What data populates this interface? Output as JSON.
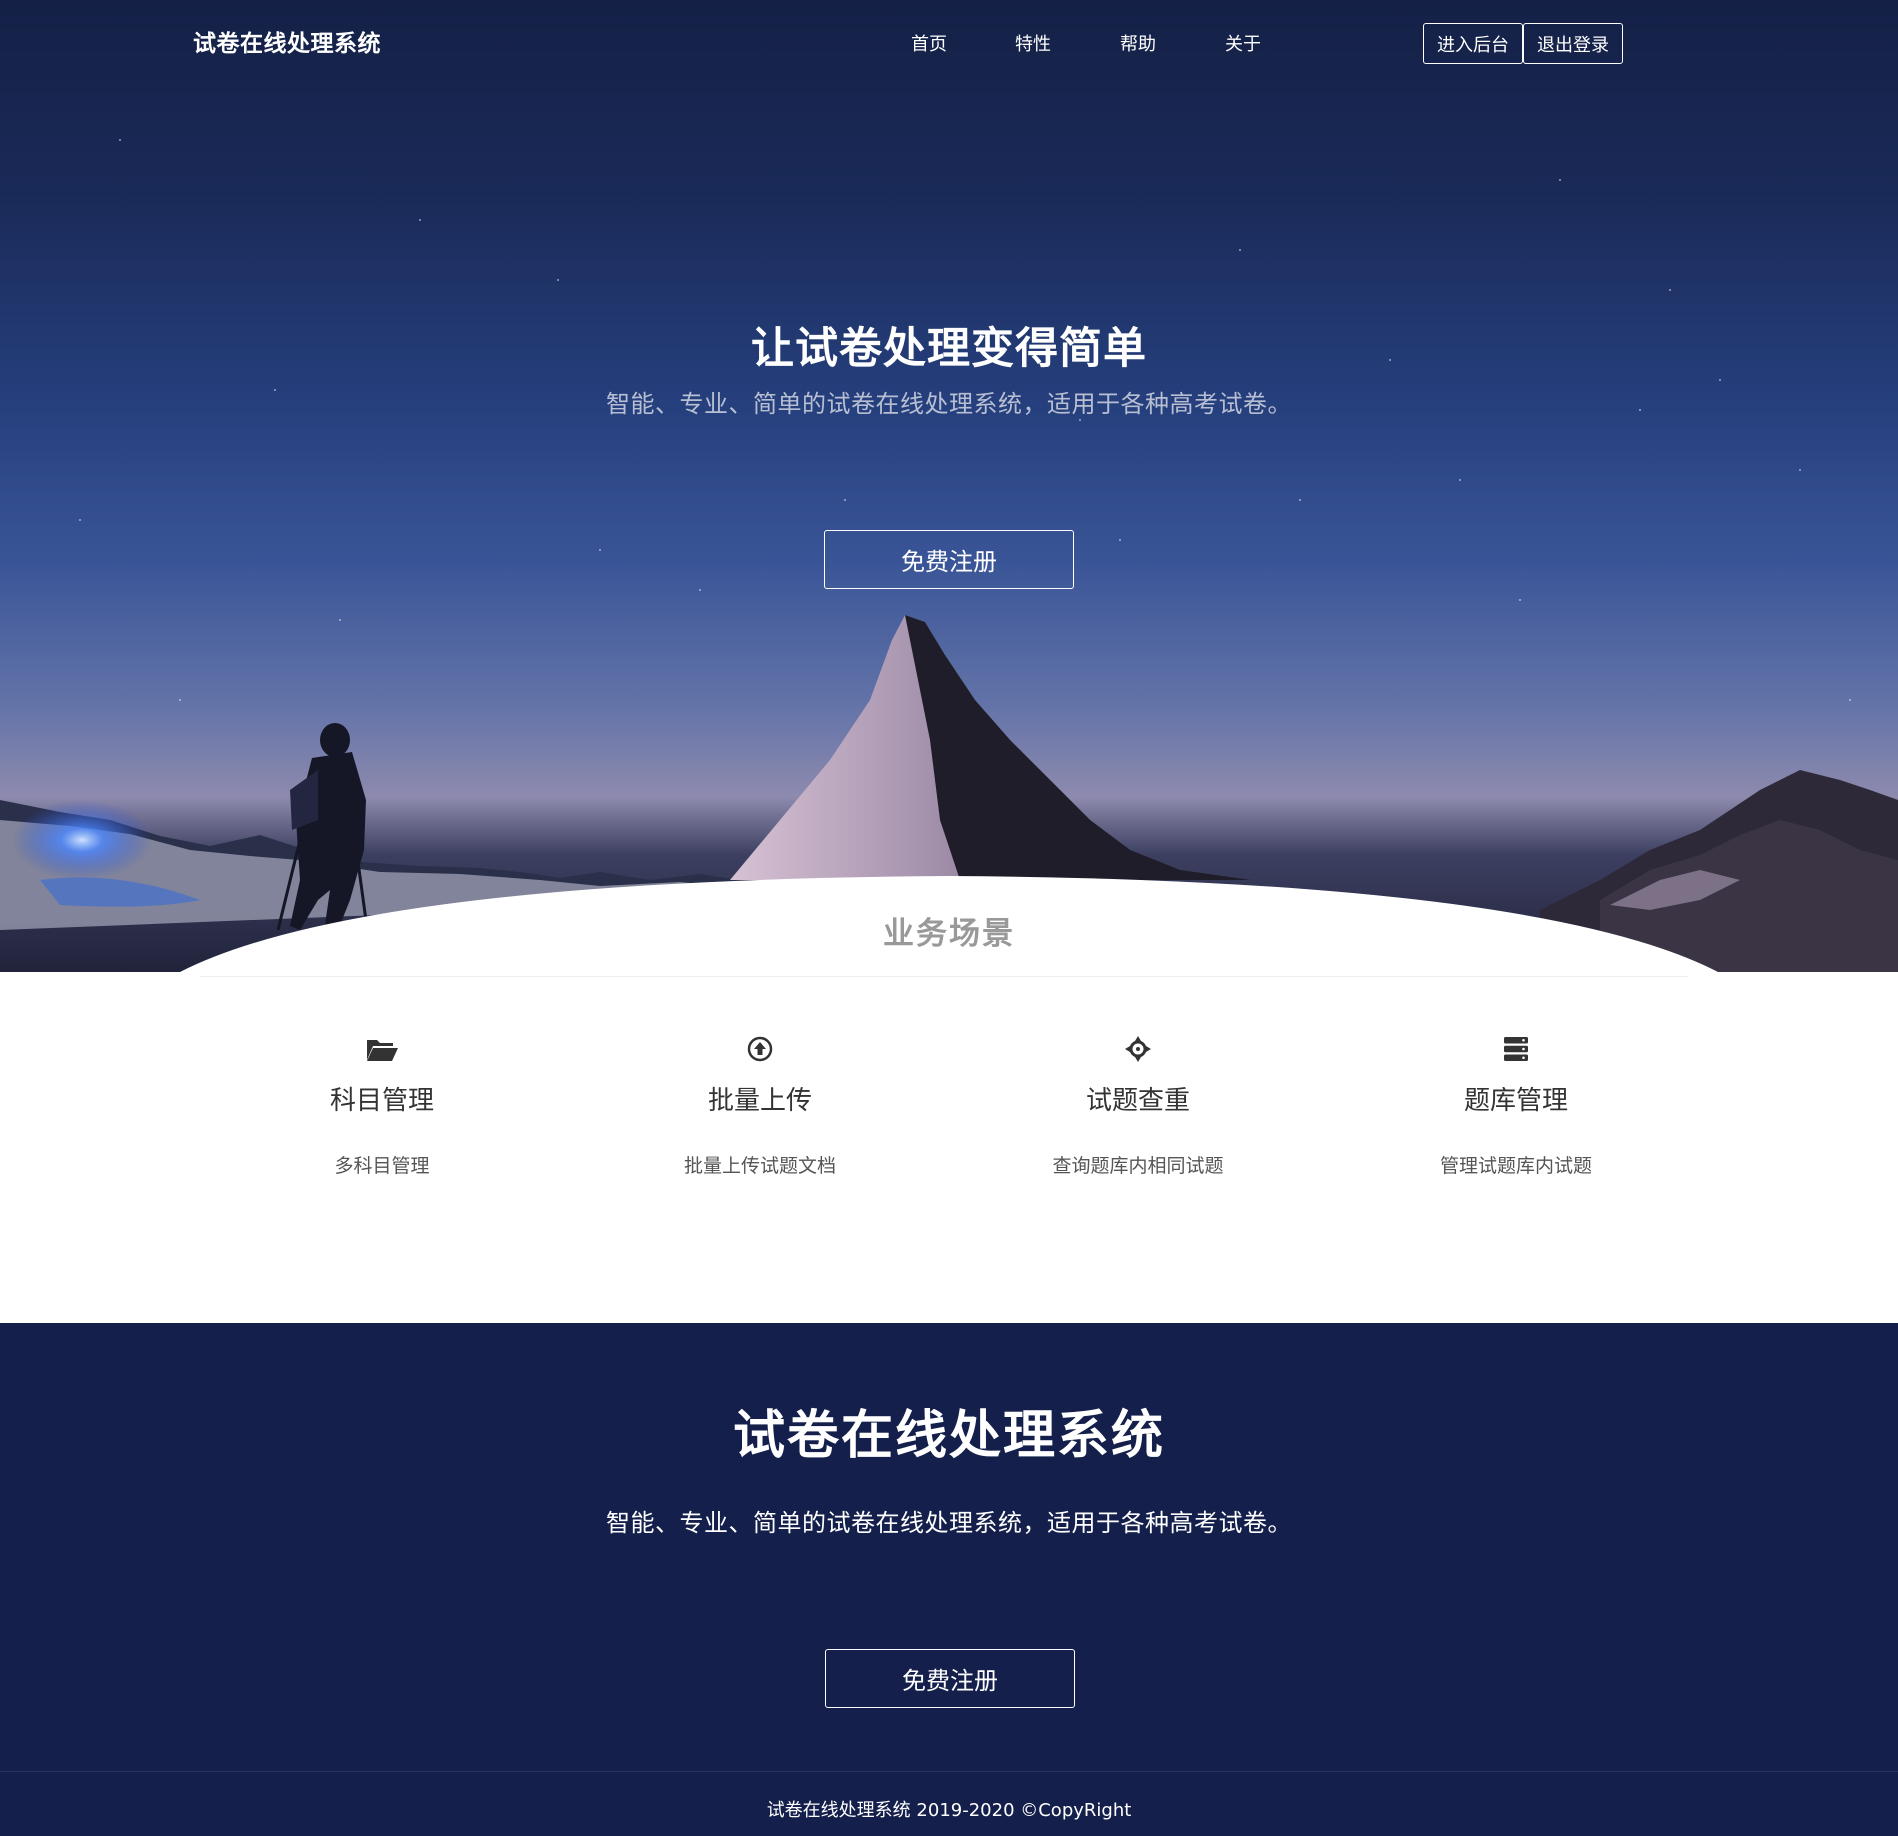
{
  "nav": {
    "brand": "试卷在线处理系统",
    "links": [
      {
        "label": "首页"
      },
      {
        "label": "特性"
      },
      {
        "label": "帮助"
      },
      {
        "label": "关于"
      }
    ],
    "admin_button": "进入后台",
    "logout_button": "退出登录"
  },
  "hero": {
    "title": "让试卷处理变得简单",
    "subtitle": "智能、专业、简单的试卷在线处理系统，适用于各种高考试卷。",
    "cta": "免费注册"
  },
  "scenarios": {
    "title": "业务场景",
    "items": [
      {
        "icon": "folder-open-icon",
        "title": "科目管理",
        "desc": "多科目管理"
      },
      {
        "icon": "upload-circle-icon",
        "title": "批量上传",
        "desc": "批量上传试题文档"
      },
      {
        "icon": "crosshair-icon",
        "title": "试题查重",
        "desc": "查询题库内相同试题"
      },
      {
        "icon": "database-icon",
        "title": "题库管理",
        "desc": "管理试题库内试题"
      }
    ]
  },
  "banner": {
    "title": "试卷在线处理系统",
    "subtitle": "智能、专业、简单的试卷在线处理系统，适用于各种高考试卷。",
    "cta": "免费注册"
  },
  "footer": {
    "text": "试卷在线处理系统 2019-2020 ©CopyRight"
  },
  "colors": {
    "navy": "#14204b",
    "white": "#ffffff",
    "muted_gray": "#999999"
  }
}
